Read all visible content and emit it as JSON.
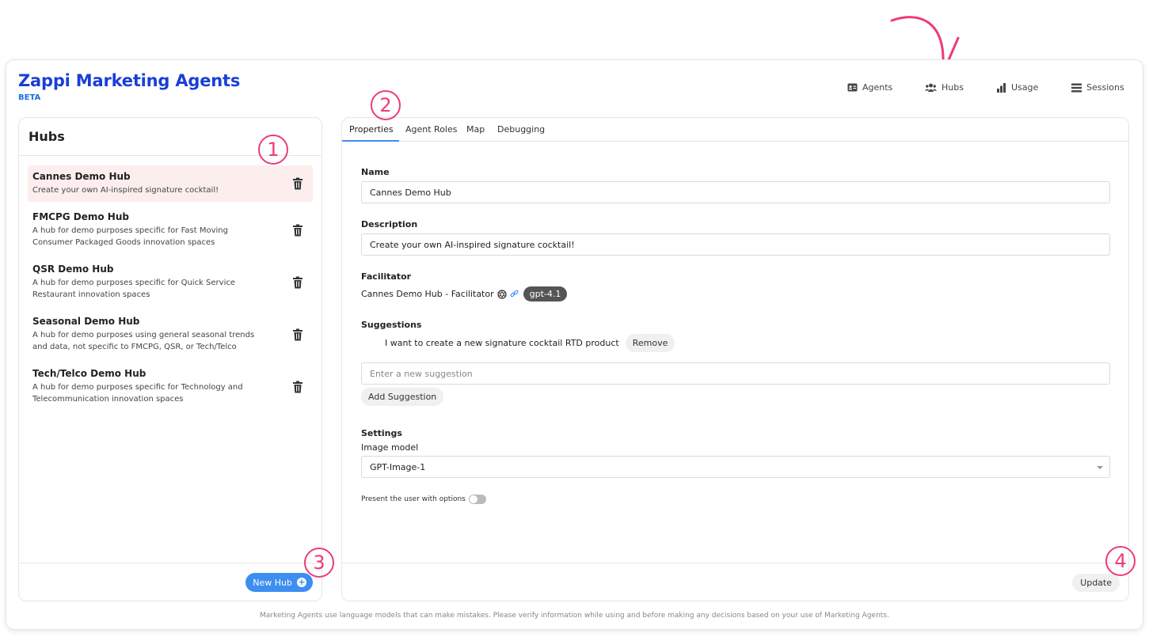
{
  "app": {
    "title": "Zappi Marketing Agents",
    "badge": "BETA"
  },
  "nav": [
    {
      "label": "Agents",
      "icon": "id-card-icon"
    },
    {
      "label": "Hubs",
      "icon": "users-icon"
    },
    {
      "label": "Usage",
      "icon": "bar-chart-icon"
    },
    {
      "label": "Sessions",
      "icon": "list-icon"
    }
  ],
  "sidebar": {
    "title": "Hubs",
    "items": [
      {
        "name": "Cannes Demo Hub",
        "description": "Create your own AI-inspired signature cocktail!",
        "selected": true
      },
      {
        "name": "FMCPG Demo Hub",
        "description": "A hub for demo purposes specific for Fast Moving Consumer Packaged Goods innovation spaces"
      },
      {
        "name": "QSR Demo Hub",
        "description": "A hub for demo purposes specific for Quick Service Restaurant innovation spaces"
      },
      {
        "name": "Seasonal Demo Hub",
        "description": "A hub for demo purposes using general seasonal trends and data, not specific to FMCPG, QSR, or Tech/Telco"
      },
      {
        "name": "Tech/Telco Demo Hub",
        "description": "A hub for demo purposes specific for Technology and Telecommunication innovation spaces"
      }
    ],
    "new_hub_label": "New Hub"
  },
  "tabs": [
    "Properties",
    "Agent Roles",
    "Map",
    "Debugging"
  ],
  "form": {
    "name_label": "Name",
    "name_value": "Cannes Demo Hub",
    "description_label": "Description",
    "description_value": "Create your own AI-inspired signature cocktail!",
    "facilitator_label": "Facilitator",
    "facilitator_value": "Cannes Demo Hub - Facilitator",
    "facilitator_model": "gpt-4.1",
    "suggestions_label": "Suggestions",
    "suggestion_1": "I want to create a new signature cocktail RTD product",
    "remove_label": "Remove",
    "new_suggestion_placeholder": "Enter a new suggestion",
    "add_suggestion_label": "Add Suggestion",
    "settings_label": "Settings",
    "image_model_label": "Image model",
    "image_model_value": "GPT-Image-1",
    "present_options_label": "Present the user with options",
    "present_options_on": false,
    "update_label": "Update"
  },
  "disclaimer": "Marketing Agents use language models that can make mistakes. Please verify information while using and before making any decisions based on your use of Marketing Agents.",
  "annotations": [
    "1",
    "2",
    "3",
    "4"
  ],
  "colors": {
    "accent": "#3d8ef0",
    "brand": "#1a3fd6",
    "annotation": "#ee3b78",
    "selected_row": "#fdeeee"
  }
}
